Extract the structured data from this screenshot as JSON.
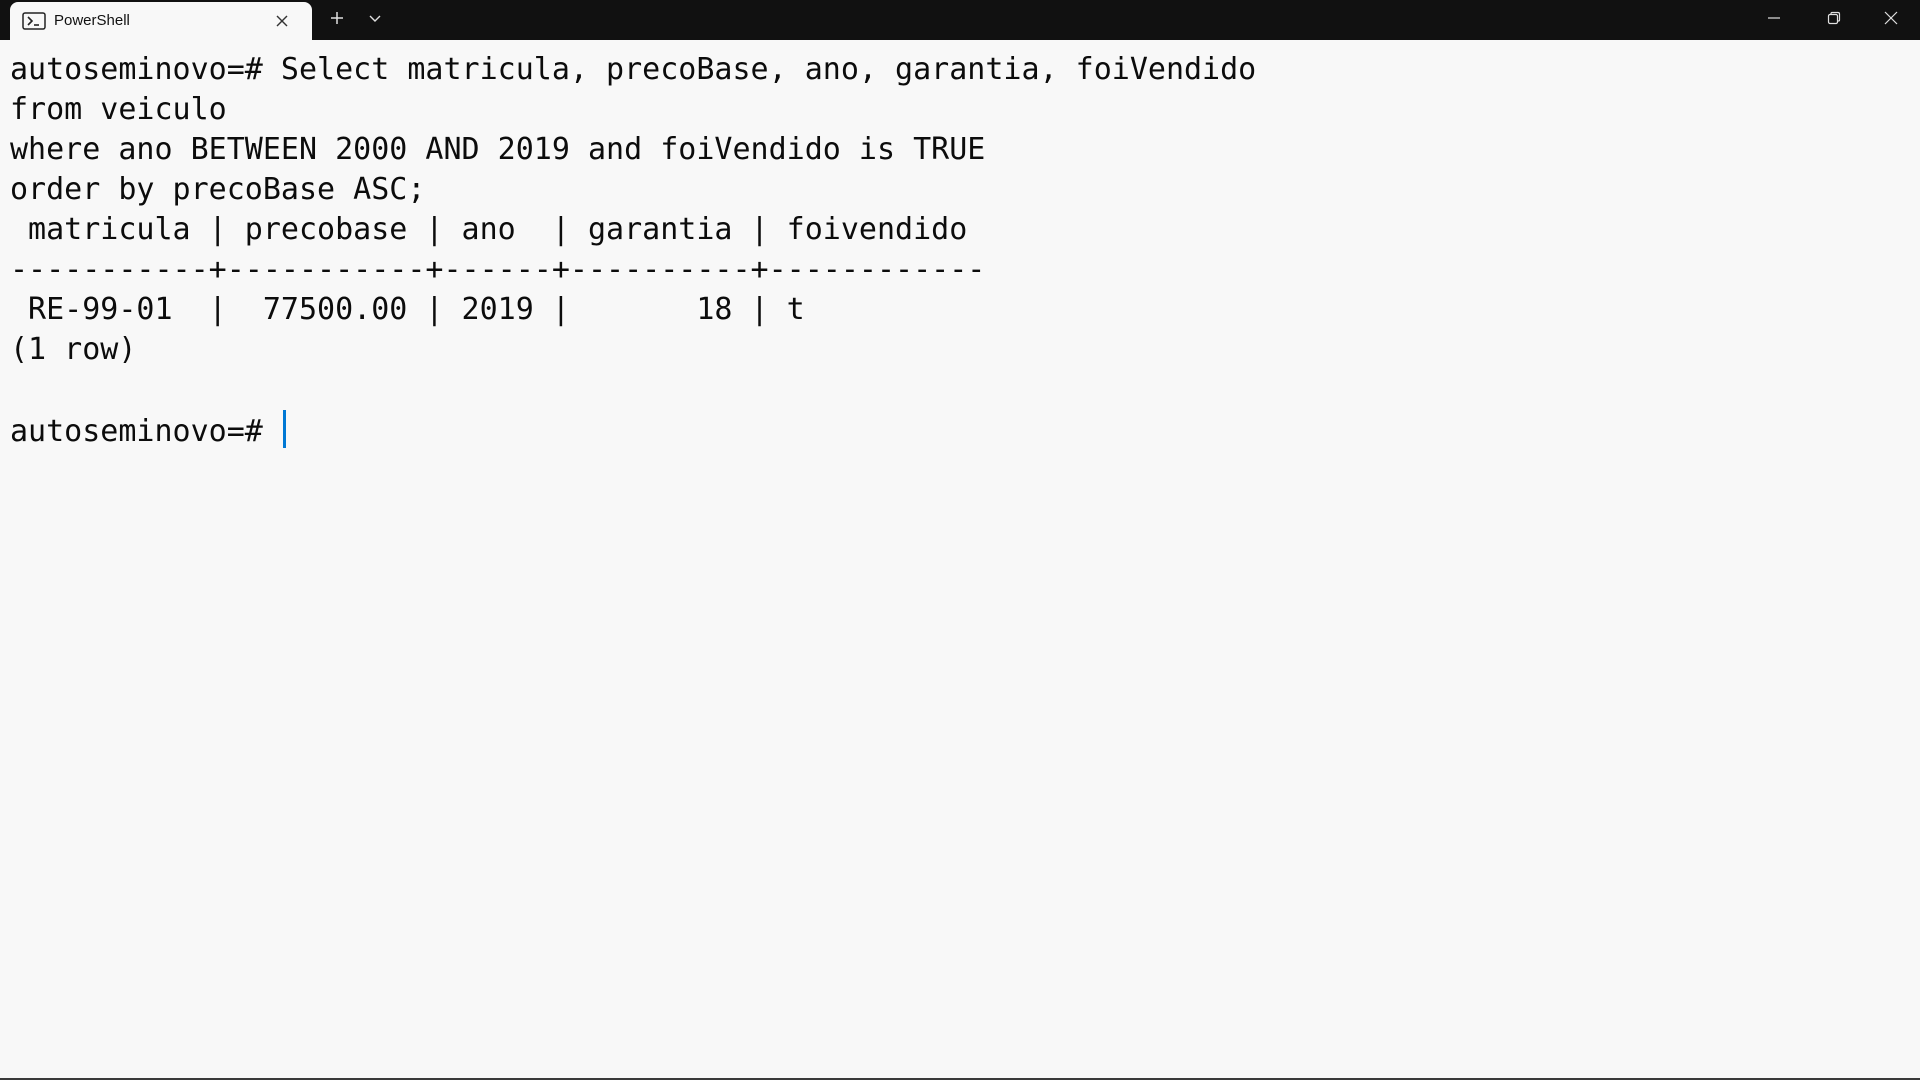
{
  "window": {
    "tab_title": "PowerShell",
    "icons": {
      "tab": "powershell-icon",
      "close_tab": "close-icon",
      "new_tab": "plus-icon",
      "dropdown": "chevron-down-icon",
      "minimize": "minimize-icon",
      "restore": "restore-icon",
      "close_window": "close-icon"
    }
  },
  "terminal": {
    "lines": [
      "autoseminovo=# Select matricula, precoBase, ano, garantia, foiVendido",
      "from veiculo",
      "where ano BETWEEN 2000 AND 2019 and foiVendido is TRUE",
      "order by precoBase ASC;",
      " matricula | precobase | ano  | garantia | foivendido",
      "-----------+-----------+------+----------+------------",
      " RE-99-01  |  77500.00 | 2019 |       18 | t",
      "(1 row)",
      ""
    ],
    "prompt": "autoseminovo=# "
  },
  "colors": {
    "titlebar": "#111111",
    "background": "#f8f8f8",
    "text": "#0c0c0c",
    "cursor": "#0078d4"
  }
}
